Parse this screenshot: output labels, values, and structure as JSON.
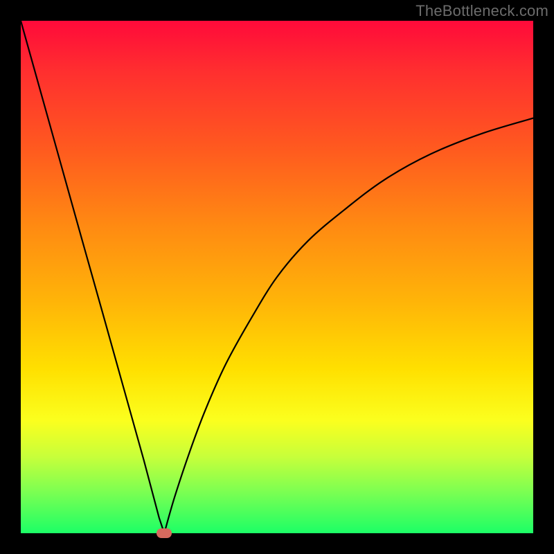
{
  "watermark": "TheBottleneck.com",
  "chart_data": {
    "type": "line",
    "title": "",
    "xlabel": "",
    "ylabel": "",
    "xlim": [
      0,
      100
    ],
    "ylim": [
      0,
      100
    ],
    "grid": false,
    "legend": false,
    "minimum_x": 28,
    "marker": {
      "x": 28,
      "y": 0,
      "color": "#d66a5e"
    },
    "series": [
      {
        "name": "left-branch",
        "x": [
          0,
          4,
          8,
          12,
          16,
          20,
          24,
          27,
          28
        ],
        "y": [
          100,
          85.7,
          71.4,
          57.1,
          42.9,
          28.6,
          14.3,
          3,
          0
        ]
      },
      {
        "name": "right-branch",
        "x": [
          28,
          30,
          33,
          36,
          40,
          45,
          50,
          56,
          63,
          71,
          80,
          90,
          100
        ],
        "y": [
          0,
          7,
          16,
          24,
          33,
          42,
          50,
          57,
          63,
          69,
          74,
          78,
          81
        ]
      }
    ],
    "background_gradient_top": "#ff0a3a",
    "background_gradient_bottom": "#1cff66",
    "frame_color": "#000000"
  }
}
